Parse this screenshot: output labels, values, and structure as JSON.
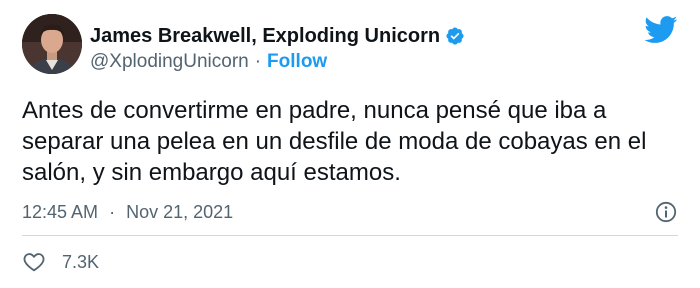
{
  "author": {
    "display_name": "James Breakwell, Exploding Unicorn",
    "handle": "@XplodingUnicorn",
    "separator": "·",
    "follow_label": "Follow"
  },
  "tweet": {
    "text": "Antes de convertirme en padre, nunca pensé que iba a separar una pelea en un desfile de moda de cobayas en el salón, y sin embargo aquí estamos.",
    "time": "12:45 AM",
    "separator": "·",
    "date": "Nov 21, 2021",
    "like_count": "7.3K"
  },
  "icons": {
    "verified": "verified-badge-icon",
    "brand": "twitter-bird-icon",
    "info": "info-icon",
    "like": "heart-icon"
  },
  "colors": {
    "accent": "#1d9bf0",
    "text": "#0f1419",
    "secondary": "#536471",
    "divider": "#cfd9de"
  }
}
